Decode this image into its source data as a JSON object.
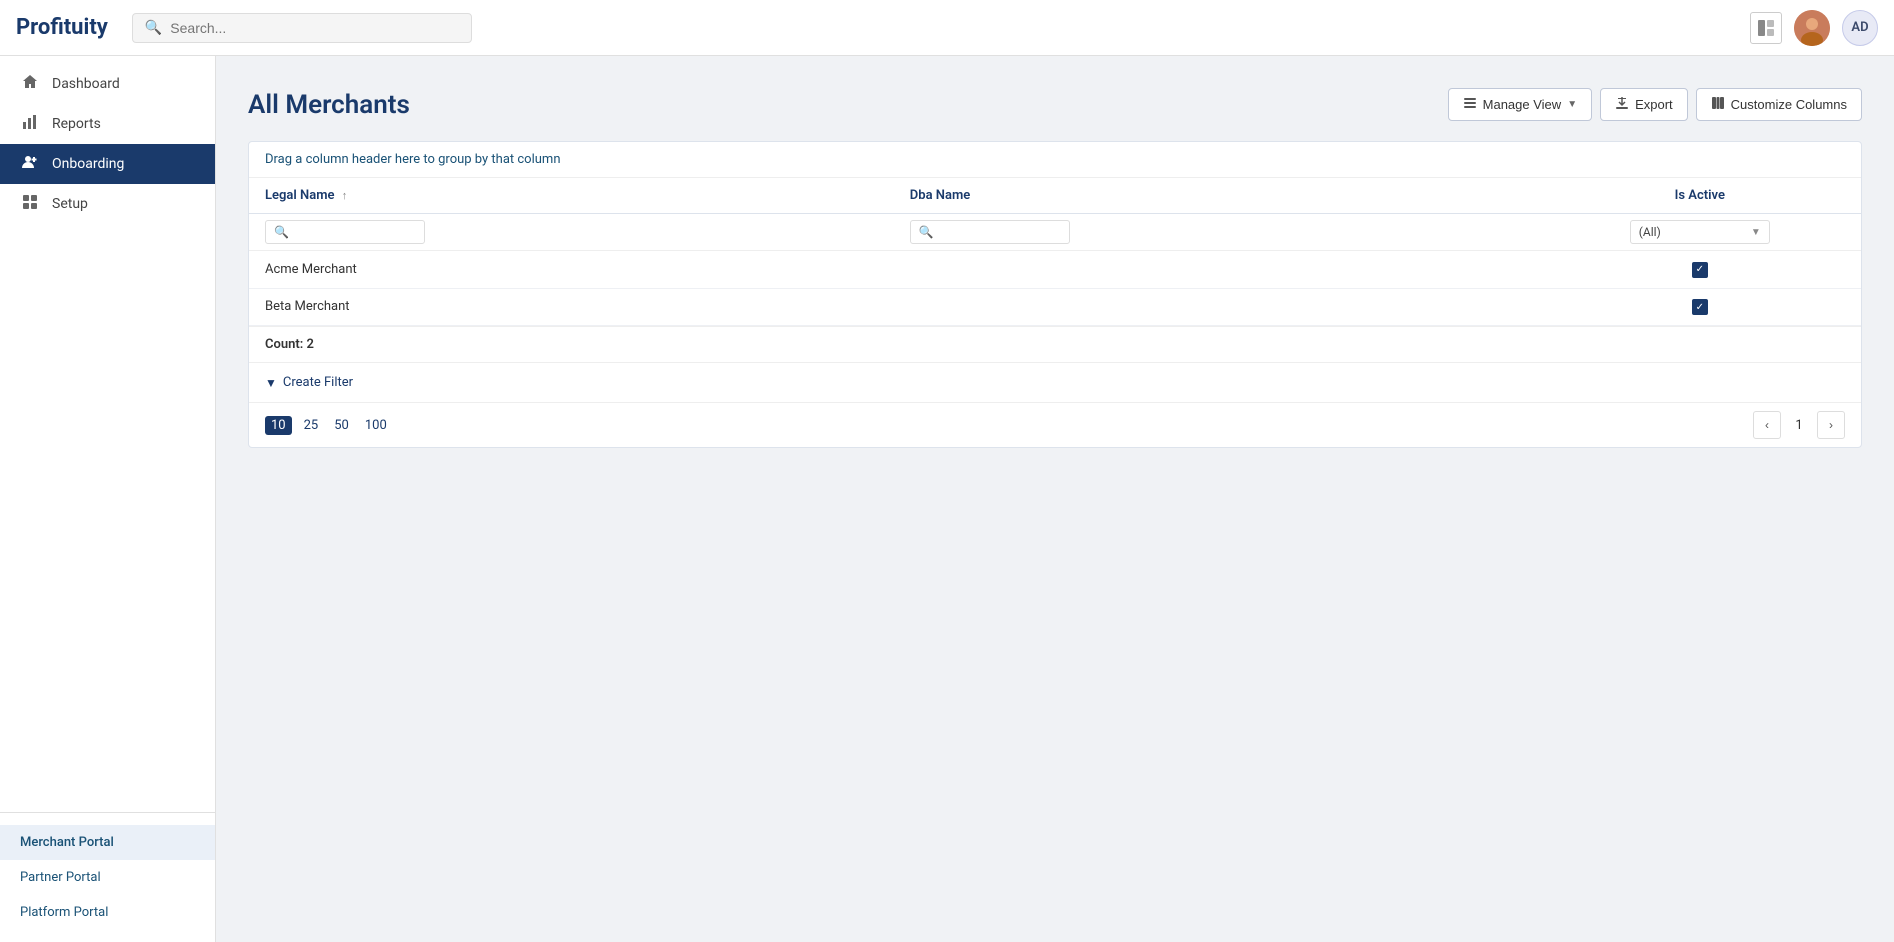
{
  "app": {
    "logo": "Profituity",
    "user_initials": "AD"
  },
  "navbar": {
    "search_placeholder": "Search...",
    "search_label": "Search -"
  },
  "sidebar": {
    "items": [
      {
        "id": "dashboard",
        "label": "Dashboard",
        "icon": "house"
      },
      {
        "id": "reports",
        "label": "Reports",
        "icon": "bar-chart"
      },
      {
        "id": "onboarding",
        "label": "Onboarding",
        "icon": "person-plus"
      },
      {
        "id": "setup",
        "label": "Setup",
        "icon": "grid"
      }
    ],
    "active": "onboarding",
    "portals": [
      {
        "id": "merchant-portal",
        "label": "Merchant Portal",
        "active": true
      },
      {
        "id": "partner-portal",
        "label": "Partner Portal",
        "active": false
      },
      {
        "id": "platform-portal",
        "label": "Platform Portal",
        "active": false
      }
    ]
  },
  "page": {
    "title": "All Merchants",
    "drag_hint": "Drag a column header here to group by that column"
  },
  "toolbar": {
    "manage_view_label": "Manage View",
    "export_label": "Export",
    "customize_columns_label": "Customize Columns"
  },
  "table": {
    "columns": [
      {
        "id": "legal-name",
        "label": "Legal Name",
        "sortable": true,
        "sort_indicator": "↑"
      },
      {
        "id": "dba-name",
        "label": "Dba Name",
        "sortable": false
      },
      {
        "id": "is-active",
        "label": "Is Active",
        "sortable": false
      }
    ],
    "filter_all_label": "(All)",
    "rows": [
      {
        "legal_name": "Acme Merchant",
        "dba_name": "",
        "is_active": true
      },
      {
        "legal_name": "Beta Merchant",
        "dba_name": "",
        "is_active": true
      }
    ],
    "count_label": "Count: 2",
    "create_filter_label": "Create Filter",
    "page_sizes": [
      "10",
      "25",
      "50",
      "100"
    ],
    "active_page_size": "10",
    "current_page": "1"
  }
}
